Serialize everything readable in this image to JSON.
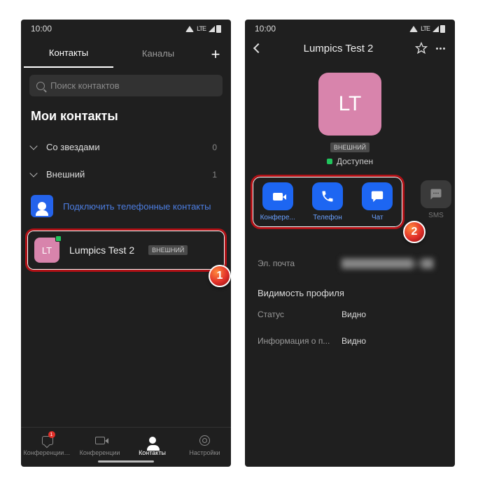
{
  "statusbar": {
    "time": "10:00",
    "net_label": "LTE"
  },
  "left": {
    "tabs": {
      "contacts": "Контакты",
      "channels": "Каналы"
    },
    "search_placeholder": "Поиск контактов",
    "section_title": "Мои контакты",
    "groups": {
      "starred": {
        "label": "Со звездами",
        "count": "0"
      },
      "external": {
        "label": "Внешний",
        "count": "1"
      }
    },
    "connect_label": "Подключить телефонные контакты",
    "contact": {
      "initials": "LT",
      "name": "Lumpics Test 2",
      "badge": "ВНЕШНИЙ"
    },
    "nav": {
      "chat": "Конференции и...",
      "chat_badge": "1",
      "meetings": "Конференции",
      "contacts": "Контакты",
      "settings": "Настройки"
    }
  },
  "right": {
    "title": "Lumpics Test 2",
    "avatar_initials": "LT",
    "ext_badge": "ВНЕШНИЙ",
    "status": "Доступен",
    "actions": {
      "meet": "Конфере...",
      "phone": "Телефон",
      "chat": "Чат",
      "sms": "SMS"
    },
    "details": {
      "email_label": "Эл. почта",
      "email_value": "████████████@██",
      "visibility_header": "Видимость профиля",
      "status_label": "Статус",
      "status_value": "Видно",
      "info_label": "Информация о п...",
      "info_value": "Видно"
    }
  },
  "steps": {
    "one": "1",
    "two": "2"
  }
}
